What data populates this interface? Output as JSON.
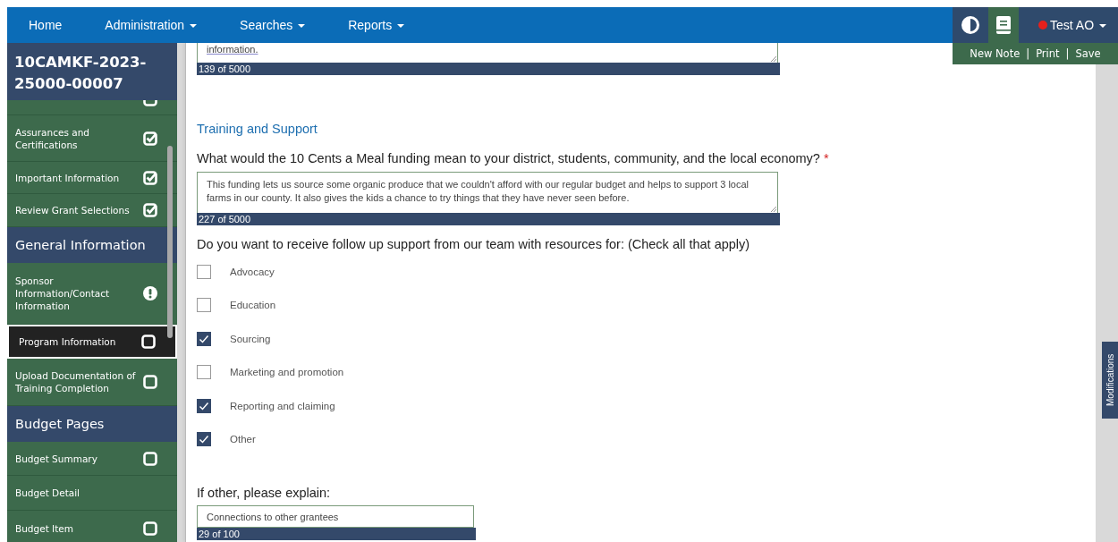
{
  "nav": {
    "items": [
      {
        "label": "Home",
        "dropdown": false
      },
      {
        "label": "Administration",
        "dropdown": true
      },
      {
        "label": "Searches",
        "dropdown": true
      },
      {
        "label": "Reports",
        "dropdown": true
      }
    ],
    "user": {
      "name": "Test AO",
      "dropdown": true
    },
    "actions": [
      "New Note",
      "Print",
      "Save"
    ],
    "separator": "|"
  },
  "sidebar": {
    "record_id": "10CAMKF-2023-25000-00007",
    "items": [
      {
        "kind": "cut",
        "selected": false
      },
      {
        "kind": "complete",
        "label": "Assurances and Certifications",
        "selected": false
      },
      {
        "kind": "complete",
        "label": "Important Information",
        "selected": false
      },
      {
        "kind": "complete",
        "label": "Review Grant Selections",
        "selected": false
      },
      {
        "kind": "header",
        "label": "General Information"
      },
      {
        "kind": "warning",
        "label": "Sponsor Information/Contact Information",
        "selected": false
      },
      {
        "kind": "incomplete",
        "label": "Program Information",
        "selected": true
      },
      {
        "kind": "incomplete",
        "label": "Upload Documentation of Training Completion",
        "selected": false
      },
      {
        "kind": "header",
        "label": "Budget Pages"
      },
      {
        "kind": "incomplete",
        "label": "Budget Summary",
        "selected": false
      },
      {
        "kind": "plain",
        "label": "Budget Detail",
        "selected": false
      },
      {
        "kind": "incomplete",
        "label": "Budget Item",
        "selected": false
      }
    ]
  },
  "form": {
    "prev_field": {
      "value": "information.",
      "counter": "139 of 5000"
    },
    "section_title": "Training and Support",
    "question": {
      "label": "What would the 10 Cents a Meal funding mean to your district, students, community, and the local economy?",
      "required_mark": "*",
      "value": "This funding lets us source some organic produce that we couldn't afford with our regular budget and helps to support 3 local farms in our county.  It also gives the kids a chance to try things that they have never seen before.",
      "counter": "227 of 5000"
    },
    "support": {
      "label": "Do you want to receive follow up support from our team with resources for: (Check all that apply)",
      "options": [
        {
          "label": "Advocacy",
          "checked": false
        },
        {
          "label": "Education",
          "checked": false
        },
        {
          "label": "Sourcing",
          "checked": true
        },
        {
          "label": "Marketing and promotion",
          "checked": false
        },
        {
          "label": "Reporting and claiming",
          "checked": true
        },
        {
          "label": "Other",
          "checked": true
        }
      ]
    },
    "other": {
      "label": "If other, please explain:",
      "value": "Connections to other grantees",
      "counter": "29 of 100"
    }
  },
  "side_tab": "Modifications"
}
